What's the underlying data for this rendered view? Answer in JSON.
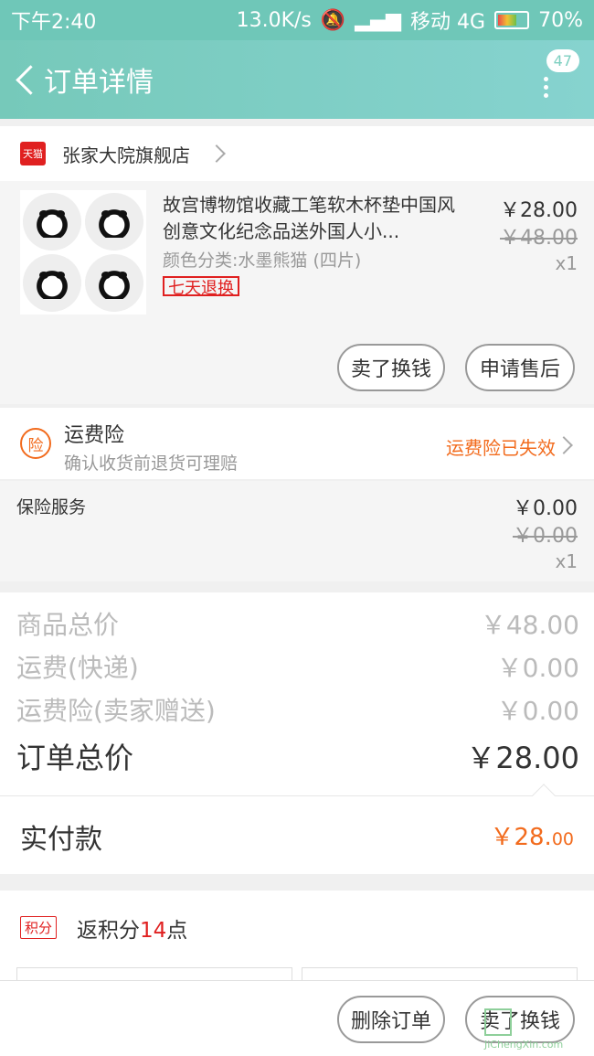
{
  "status_bar": {
    "time": "下午2:40",
    "net_speed": "13.0K/s",
    "carrier": "移动 4G",
    "battery": "70%"
  },
  "nav": {
    "title": "订单详情",
    "badge": "47"
  },
  "shop": {
    "icon_text": "天猫",
    "name": "张家大院旗舰店"
  },
  "product": {
    "title": "故宫博物馆收藏工笔软木杯垫中国风创意文化纪念品送外国人小...",
    "spec": "颜色分类:水墨熊猫 (四片)",
    "tag": "七天退换",
    "price": "￥28.00",
    "original_price": "￥48.00",
    "quantity": "x1",
    "btn_exchange": "卖了换钱",
    "btn_aftersale": "申请售后"
  },
  "insurance": {
    "icon_text": "险",
    "title": "运费险",
    "subtitle": "确认收货前退货可理赔",
    "status": "运费险已失效"
  },
  "service": {
    "label": "保险服务",
    "price": "￥0.00",
    "original_price": "￥0.00",
    "quantity": "x1"
  },
  "totals": {
    "goods_label": "商品总价",
    "goods_value": "￥48.00",
    "shipping_label": "运费(快递)",
    "shipping_value": "￥0.00",
    "insurance_label": "运费险(卖家赠送)",
    "insurance_value": "￥0.00",
    "order_label": "订单总价",
    "order_value": "￥28.00"
  },
  "paid": {
    "label": "实付款",
    "amount_main": "￥28.",
    "amount_decimal": "00"
  },
  "points": {
    "tag": "积分",
    "text_prefix": "返积分",
    "count": "14",
    "text_suffix": "点"
  },
  "bottom": {
    "btn_delete": "删除订单",
    "btn_sell": "卖了换钱"
  },
  "watermark": {
    "text": "JiChengXin.com"
  },
  "colors": {
    "accent": "#76c9ba",
    "orange": "#f26b1d",
    "red": "#e02020"
  }
}
